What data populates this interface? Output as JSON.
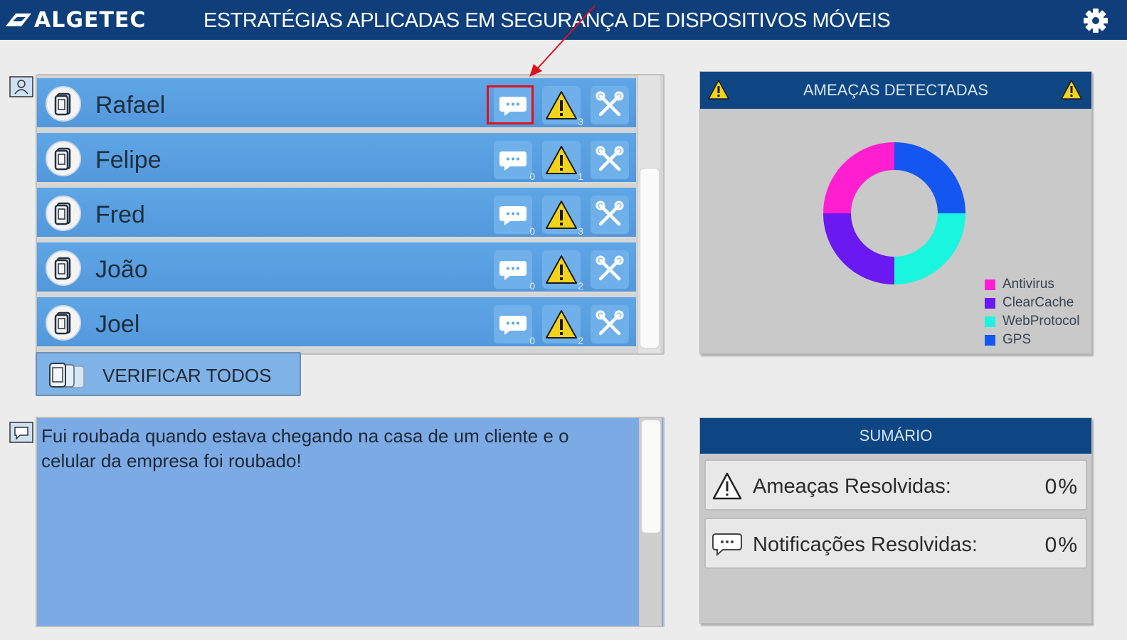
{
  "header": {
    "logo_text": "ALGETEC",
    "title": "ESTRATÉGIAS APLICADAS EM SEGURANÇA DE DISPOSITIVOS MÓVEIS",
    "settings_icon": "gear-icon"
  },
  "devices": [
    {
      "name": "Rafael",
      "notifications": "",
      "threats": "3"
    },
    {
      "name": "Felipe",
      "notifications": "0",
      "threats": "1"
    },
    {
      "name": "Fred",
      "notifications": "0",
      "threats": "3"
    },
    {
      "name": "João",
      "notifications": "0",
      "threats": "2"
    },
    {
      "name": "Joel",
      "notifications": "0",
      "threats": "2"
    }
  ],
  "verify_all": {
    "label": "VERIFICAR TODOS"
  },
  "message": {
    "text": "Fui roubada quando estava chegando na casa de um cliente e o celular da empresa foi roubado!"
  },
  "threats_card": {
    "title": "AMEAÇAS DETECTADAS",
    "legend": [
      {
        "name": "Antivirus",
        "color": "#ff1fd1",
        "value": 1
      },
      {
        "name": "ClearCache",
        "color": "#6a19f0",
        "value": 1
      },
      {
        "name": "WebProtocol",
        "color": "#19f5df",
        "value": 1
      },
      {
        "name": "GPS",
        "color": "#1457f0",
        "value": 1
      }
    ]
  },
  "summary": {
    "title": "SUMÁRIO",
    "threats_resolved_label": "Ameaças Resolvidas:",
    "threats_resolved_value": "0%",
    "notifications_resolved_label": "Notificações Resolvidas:",
    "notifications_resolved_value": "0%"
  },
  "colors": {
    "header_bg": "#0e3f7a",
    "row_bg": "#5ea6e6",
    "warning": "#f2d21a",
    "highlight": "#e0101e"
  }
}
